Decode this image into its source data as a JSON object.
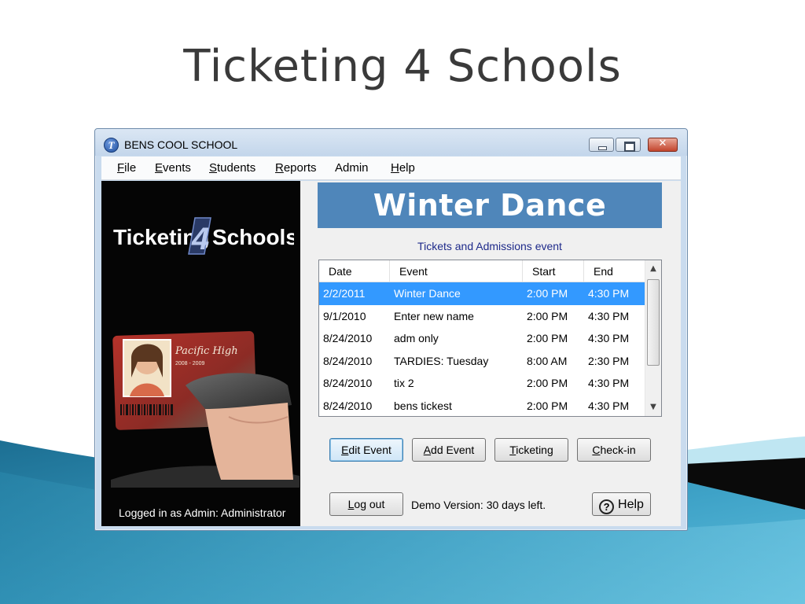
{
  "slide": {
    "title": "Ticketing 4 Schools"
  },
  "window": {
    "title": "BENS COOL SCHOOL",
    "controls": [
      "minimize",
      "maximize",
      "close"
    ]
  },
  "menu": [
    {
      "label": "File",
      "accel": "F",
      "rest": "ile"
    },
    {
      "label": "Events",
      "accel": "E",
      "rest": "vents"
    },
    {
      "label": "Students",
      "accel": "S",
      "rest": "tudents"
    },
    {
      "label": "Reports",
      "accel": "R",
      "rest": "eports"
    },
    {
      "label": "Admin",
      "accel": "",
      "rest": "Admin"
    },
    {
      "label": "Help",
      "accel": "H",
      "rest": "elp"
    }
  ],
  "brand": {
    "logo_left": "Ticketing",
    "logo_mid": "4",
    "logo_right": "Schools",
    "card_school": "Pacific High",
    "card_years": "2008 - 2009",
    "status": "Logged in as Admin: Administrator"
  },
  "event": {
    "name": "Winter Dance",
    "subtitle": "Tickets and Admissions event"
  },
  "table": {
    "columns": [
      "Date",
      "Event",
      "Start",
      "End"
    ],
    "rows": [
      {
        "date": "2/2/2011",
        "event": "Winter Dance",
        "start": "2:00 PM",
        "end": "4:30 PM",
        "selected": true
      },
      {
        "date": "9/1/2010",
        "event": "Enter new name",
        "start": "2:00 PM",
        "end": "4:30 PM",
        "selected": false
      },
      {
        "date": "8/24/2010",
        "event": "adm only",
        "start": "2:00 PM",
        "end": "4:30 PM",
        "selected": false
      },
      {
        "date": "8/24/2010",
        "event": "TARDIES: Tuesday",
        "start": "8:00 AM",
        "end": "2:30 PM",
        "selected": false
      },
      {
        "date": "8/24/2010",
        "event": "tix 2",
        "start": "2:00 PM",
        "end": "4:30 PM",
        "selected": false
      },
      {
        "date": "8/24/2010",
        "event": "bens tickest",
        "start": "2:00 PM",
        "end": "4:30 PM",
        "selected": false
      }
    ]
  },
  "buttons": {
    "edit_event": {
      "accel": "E",
      "rest": "dit Event"
    },
    "add_event": {
      "accel": "A",
      "rest": "dd Event"
    },
    "ticketing": {
      "accel": "T",
      "rest": "icketing"
    },
    "check_in": {
      "accel": "C",
      "rest": "heck-in"
    },
    "log_out": {
      "accel": "L",
      "rest": "og out"
    },
    "help": {
      "label": "Help"
    }
  },
  "demo_notice": "Demo Version: 30 days left.",
  "colors": {
    "banner": "#4f86ba",
    "selection": "#3399ff",
    "subtitle_text": "#1e2a8a"
  }
}
